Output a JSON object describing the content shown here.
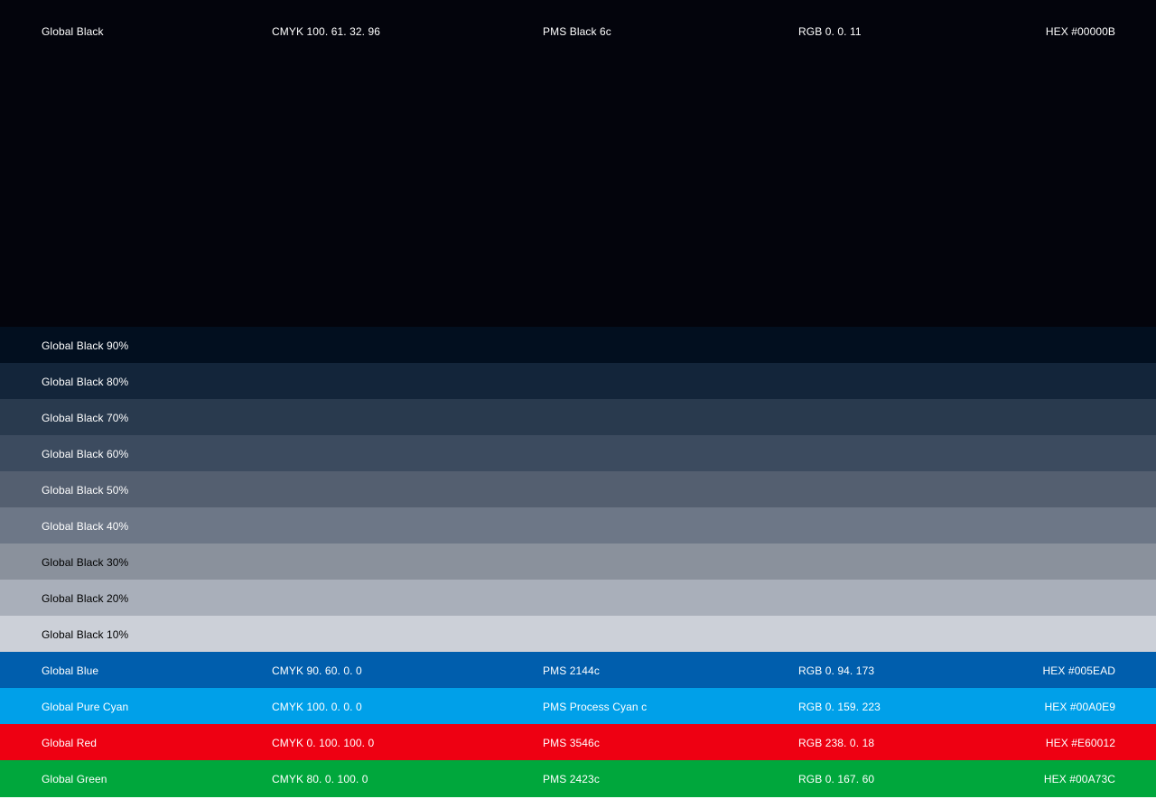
{
  "swatches": [
    {
      "id": "black",
      "name": "Global Black",
      "cmyk": "CMYK  100. 61. 32. 96",
      "pms": "PMS  Black 6c",
      "rgb": "RGB  0. 0. 11",
      "hex": "HEX  #00000B",
      "color": "#03040c",
      "text": "light"
    },
    {
      "id": "black90",
      "name": "Global Black 90%",
      "color": "#020f1f",
      "text": "light"
    },
    {
      "id": "black80",
      "name": "Global Black 80%",
      "color": "#13253a",
      "text": "light"
    },
    {
      "id": "black70",
      "name": "Global Black 70%",
      "color": "#293a4e",
      "text": "light"
    },
    {
      "id": "black60",
      "name": "Global Black 60%",
      "color": "#3c4b5f",
      "text": "light"
    },
    {
      "id": "black50",
      "name": "Global Black 50%",
      "color": "#545f70",
      "text": "light"
    },
    {
      "id": "black40",
      "name": "Global Black 40%",
      "color": "#6d7787",
      "text": "light"
    },
    {
      "id": "black30",
      "name": "Global Black 30%",
      "color": "#8a919c",
      "text": "dark"
    },
    {
      "id": "black20",
      "name": "Global Black 20%",
      "color": "#a9afba",
      "text": "dark"
    },
    {
      "id": "black10",
      "name": "Global Black 10%",
      "color": "#ccd0d8",
      "text": "dark"
    },
    {
      "id": "blue",
      "name": "Global Blue",
      "cmyk": "CMYK  90. 60. 0. 0",
      "pms": "PMS  2144c",
      "rgb": "RGB  0. 94. 173",
      "hex": "HEX  #005EAD",
      "color": "#005ead",
      "text": "light"
    },
    {
      "id": "cyan",
      "name": "Global Pure Cyan",
      "cmyk": "CMYK  100. 0. 0. 0",
      "pms": "PMS  Process Cyan c",
      "rgb": "RGB  0. 159. 223",
      "hex": "HEX  #00A0E9",
      "color": "#00a0e9",
      "text": "light"
    },
    {
      "id": "red",
      "name": "Global Red",
      "cmyk": "CMYK  0. 100. 100. 0",
      "pms": "PMS  3546c",
      "rgb": "RGB  238. 0. 18",
      "hex": "HEX  #E60012",
      "color": "#ee0012",
      "text": "light"
    },
    {
      "id": "green",
      "name": "Global Green",
      "cmyk": "CMYK  80. 0. 100. 0",
      "pms": "PMS  2423c",
      "rgb": "RGB  0. 167. 60",
      "hex": "HEX  #00A73C",
      "color": "#00a73c",
      "text": "light"
    }
  ]
}
